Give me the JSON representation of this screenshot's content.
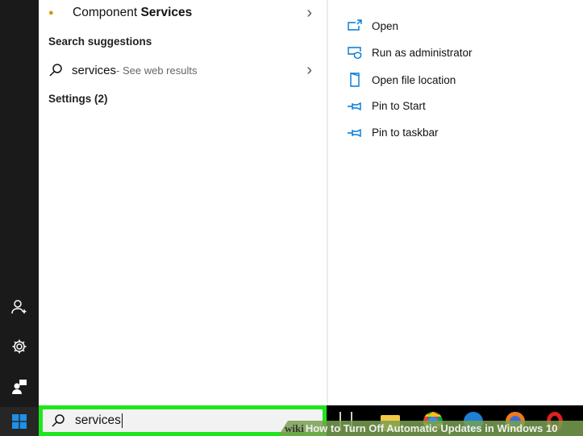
{
  "results": {
    "best_match": {
      "label_pre": "Component ",
      "label_bold": "Services"
    },
    "suggestions_header": "Search suggestions",
    "suggestion": {
      "query": "services",
      "suffix": " - See web results"
    },
    "settings_header": "Settings (2)"
  },
  "actions": [
    {
      "label": "Open",
      "icon": "open-icon"
    },
    {
      "label": "Run as administrator",
      "icon": "shield-icon"
    },
    {
      "label": "Open file location",
      "icon": "folder-icon"
    },
    {
      "label": "Pin to Start",
      "icon": "pin-icon"
    },
    {
      "label": "Pin to taskbar",
      "icon": "pin-icon"
    }
  ],
  "search": {
    "value": "services"
  },
  "watermark": {
    "brand": "wiki",
    "title": "How to Turn Off Automatic Updates in Windows 10"
  },
  "colors": {
    "accent": "#0078d7",
    "highlight": "#1ee61e"
  }
}
